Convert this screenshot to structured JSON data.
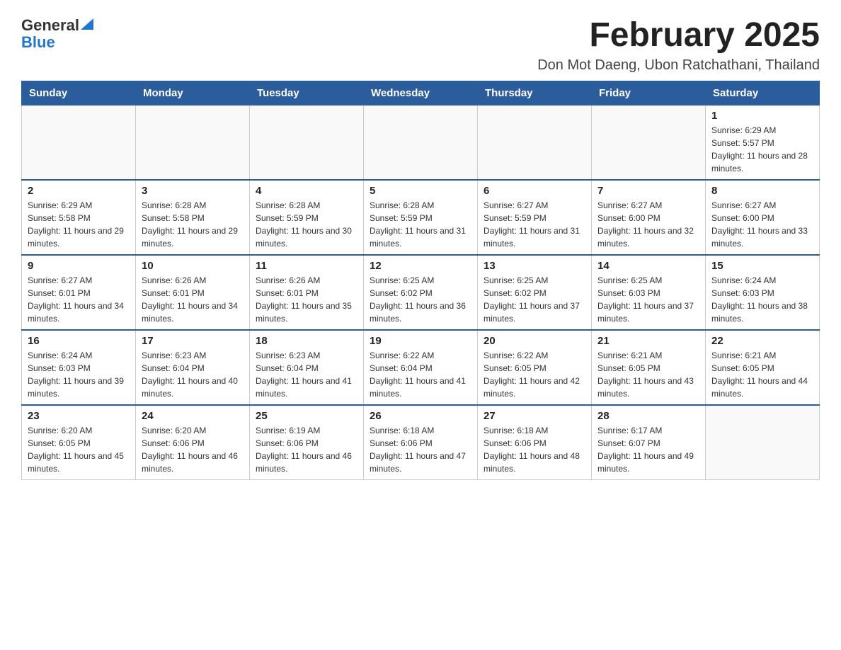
{
  "header": {
    "logo_general": "General",
    "logo_blue": "Blue",
    "title": "February 2025",
    "subtitle": "Don Mot Daeng, Ubon Ratchathani, Thailand"
  },
  "weekdays": [
    "Sunday",
    "Monday",
    "Tuesday",
    "Wednesday",
    "Thursday",
    "Friday",
    "Saturday"
  ],
  "weeks": [
    [
      {
        "day": "",
        "info": ""
      },
      {
        "day": "",
        "info": ""
      },
      {
        "day": "",
        "info": ""
      },
      {
        "day": "",
        "info": ""
      },
      {
        "day": "",
        "info": ""
      },
      {
        "day": "",
        "info": ""
      },
      {
        "day": "1",
        "info": "Sunrise: 6:29 AM\nSunset: 5:57 PM\nDaylight: 11 hours and 28 minutes."
      }
    ],
    [
      {
        "day": "2",
        "info": "Sunrise: 6:29 AM\nSunset: 5:58 PM\nDaylight: 11 hours and 29 minutes."
      },
      {
        "day": "3",
        "info": "Sunrise: 6:28 AM\nSunset: 5:58 PM\nDaylight: 11 hours and 29 minutes."
      },
      {
        "day": "4",
        "info": "Sunrise: 6:28 AM\nSunset: 5:59 PM\nDaylight: 11 hours and 30 minutes."
      },
      {
        "day": "5",
        "info": "Sunrise: 6:28 AM\nSunset: 5:59 PM\nDaylight: 11 hours and 31 minutes."
      },
      {
        "day": "6",
        "info": "Sunrise: 6:27 AM\nSunset: 5:59 PM\nDaylight: 11 hours and 31 minutes."
      },
      {
        "day": "7",
        "info": "Sunrise: 6:27 AM\nSunset: 6:00 PM\nDaylight: 11 hours and 32 minutes."
      },
      {
        "day": "8",
        "info": "Sunrise: 6:27 AM\nSunset: 6:00 PM\nDaylight: 11 hours and 33 minutes."
      }
    ],
    [
      {
        "day": "9",
        "info": "Sunrise: 6:27 AM\nSunset: 6:01 PM\nDaylight: 11 hours and 34 minutes."
      },
      {
        "day": "10",
        "info": "Sunrise: 6:26 AM\nSunset: 6:01 PM\nDaylight: 11 hours and 34 minutes."
      },
      {
        "day": "11",
        "info": "Sunrise: 6:26 AM\nSunset: 6:01 PM\nDaylight: 11 hours and 35 minutes."
      },
      {
        "day": "12",
        "info": "Sunrise: 6:25 AM\nSunset: 6:02 PM\nDaylight: 11 hours and 36 minutes."
      },
      {
        "day": "13",
        "info": "Sunrise: 6:25 AM\nSunset: 6:02 PM\nDaylight: 11 hours and 37 minutes."
      },
      {
        "day": "14",
        "info": "Sunrise: 6:25 AM\nSunset: 6:03 PM\nDaylight: 11 hours and 37 minutes."
      },
      {
        "day": "15",
        "info": "Sunrise: 6:24 AM\nSunset: 6:03 PM\nDaylight: 11 hours and 38 minutes."
      }
    ],
    [
      {
        "day": "16",
        "info": "Sunrise: 6:24 AM\nSunset: 6:03 PM\nDaylight: 11 hours and 39 minutes."
      },
      {
        "day": "17",
        "info": "Sunrise: 6:23 AM\nSunset: 6:04 PM\nDaylight: 11 hours and 40 minutes."
      },
      {
        "day": "18",
        "info": "Sunrise: 6:23 AM\nSunset: 6:04 PM\nDaylight: 11 hours and 41 minutes."
      },
      {
        "day": "19",
        "info": "Sunrise: 6:22 AM\nSunset: 6:04 PM\nDaylight: 11 hours and 41 minutes."
      },
      {
        "day": "20",
        "info": "Sunrise: 6:22 AM\nSunset: 6:05 PM\nDaylight: 11 hours and 42 minutes."
      },
      {
        "day": "21",
        "info": "Sunrise: 6:21 AM\nSunset: 6:05 PM\nDaylight: 11 hours and 43 minutes."
      },
      {
        "day": "22",
        "info": "Sunrise: 6:21 AM\nSunset: 6:05 PM\nDaylight: 11 hours and 44 minutes."
      }
    ],
    [
      {
        "day": "23",
        "info": "Sunrise: 6:20 AM\nSunset: 6:05 PM\nDaylight: 11 hours and 45 minutes."
      },
      {
        "day": "24",
        "info": "Sunrise: 6:20 AM\nSunset: 6:06 PM\nDaylight: 11 hours and 46 minutes."
      },
      {
        "day": "25",
        "info": "Sunrise: 6:19 AM\nSunset: 6:06 PM\nDaylight: 11 hours and 46 minutes."
      },
      {
        "day": "26",
        "info": "Sunrise: 6:18 AM\nSunset: 6:06 PM\nDaylight: 11 hours and 47 minutes."
      },
      {
        "day": "27",
        "info": "Sunrise: 6:18 AM\nSunset: 6:06 PM\nDaylight: 11 hours and 48 minutes."
      },
      {
        "day": "28",
        "info": "Sunrise: 6:17 AM\nSunset: 6:07 PM\nDaylight: 11 hours and 49 minutes."
      },
      {
        "day": "",
        "info": ""
      }
    ]
  ]
}
